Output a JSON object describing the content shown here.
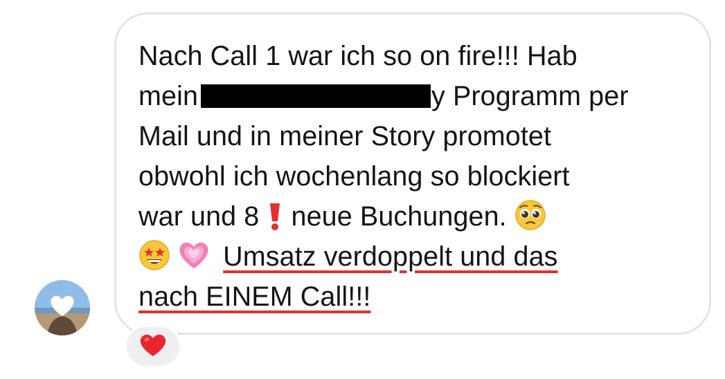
{
  "message": {
    "line1": "Nach Call 1 war ich so on fire!!! Hab",
    "line2_start": "mein",
    "line2_end": "y Programm per",
    "line3": "Mail und in meiner Story promotet",
    "line4": "obwohl ich wochenlang so blockiert",
    "line5_text": "war und 8",
    "line5_text2": "neue Buchungen.",
    "line6_underlined": "Umsatz verdoppelt und das",
    "line7_underlined": "nach EINEM Call!!!"
  },
  "colors": {
    "bubble_border": "#e4e4e8",
    "underline": "#e2302e",
    "reaction_bg": "#efeff2",
    "text": "#141414"
  },
  "icons": [
    "exclamation-icon",
    "pleading-face-icon",
    "star-struck-icon",
    "growing-heart-icon",
    "heart-reaction-icon",
    "white-heart-icon"
  ]
}
